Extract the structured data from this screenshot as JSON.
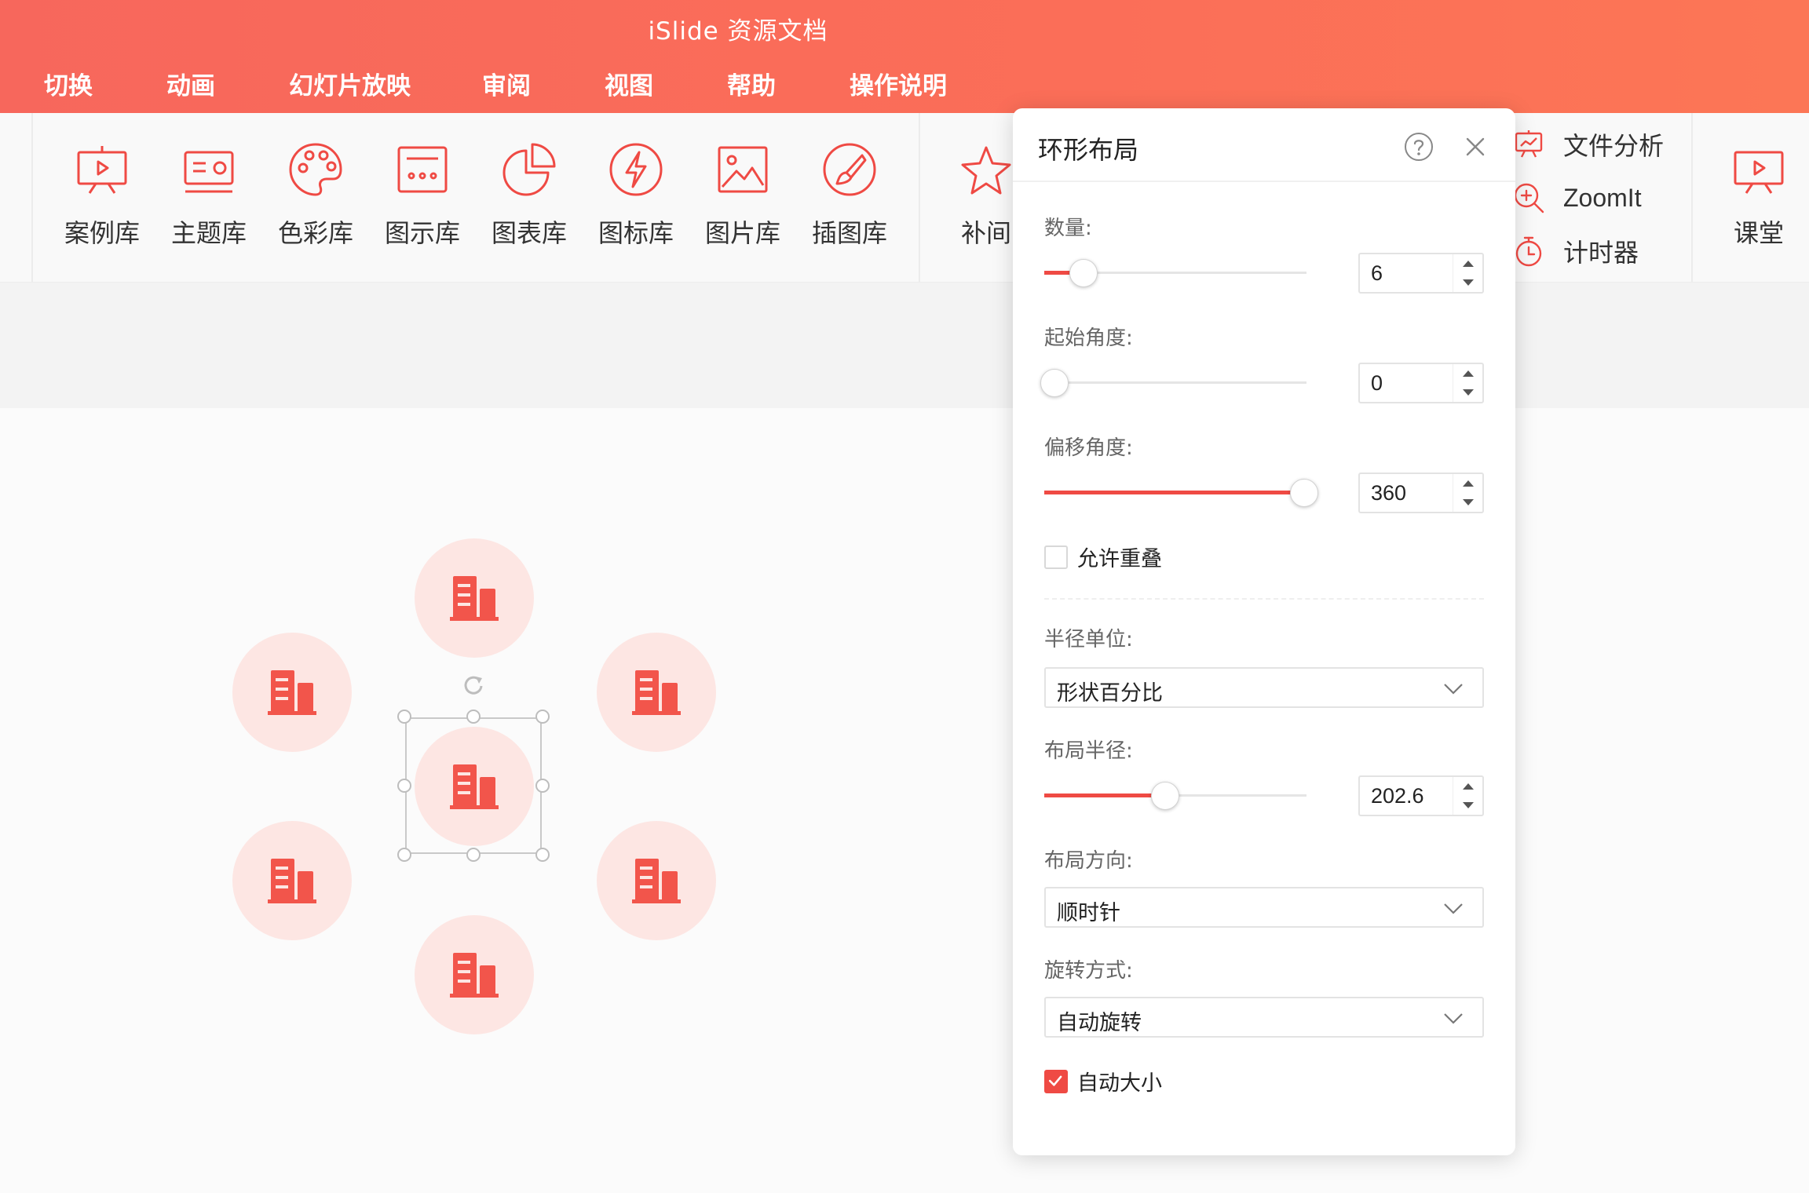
{
  "app": {
    "title": "iSlide 资源文档"
  },
  "menu": {
    "items": [
      "切换",
      "动画",
      "幻灯片放映",
      "审阅",
      "视图",
      "帮助",
      "操作说明"
    ]
  },
  "ribbon": {
    "buttons": [
      {
        "label": "案例库",
        "icon": "presentation-icon"
      },
      {
        "label": "主题库",
        "icon": "theme-icon"
      },
      {
        "label": "色彩库",
        "icon": "palette-icon"
      },
      {
        "label": "图示库",
        "icon": "diagram-icon"
      },
      {
        "label": "图表库",
        "icon": "pie-chart-icon"
      },
      {
        "label": "图标库",
        "icon": "lightning-icon"
      },
      {
        "label": "图片库",
        "icon": "picture-icon"
      },
      {
        "label": "插图库",
        "icon": "brush-icon"
      },
      {
        "label": "补间",
        "icon": "star-icon"
      }
    ],
    "small_buttons": [
      {
        "label": "文件分析",
        "icon": "file-analysis-icon"
      },
      {
        "label": "ZoomIt",
        "icon": "zoom-icon"
      },
      {
        "label": "计时器",
        "icon": "timer-icon"
      }
    ],
    "classroom": {
      "label": "课堂",
      "icon": "classroom-icon"
    }
  },
  "dialog": {
    "title": "环形布局",
    "count": {
      "label": "数量:",
      "value": "6",
      "slider_fraction": 0.15
    },
    "start_angle": {
      "label": "起始角度:",
      "value": "0",
      "slider_fraction": 0.04
    },
    "offset_angle": {
      "label": "偏移角度:",
      "value": "360",
      "slider_fraction": 0.99
    },
    "allow_overlap": {
      "label": "允许重叠",
      "checked": false
    },
    "radius_unit": {
      "label": "半径单位:",
      "value": "形状百分比"
    },
    "layout_radius": {
      "label": "布局半径:",
      "value": "202.6",
      "slider_fraction": 0.46
    },
    "direction": {
      "label": "布局方向:",
      "value": "顺时针"
    },
    "rotation": {
      "label": "旋转方式:",
      "value": "自动旋转"
    },
    "auto_size": {
      "label": "自动大小",
      "checked": true
    }
  },
  "colors": {
    "accent": "#ef4a44",
    "node_bg": "#fde6e3",
    "icon": "#f2554b"
  }
}
